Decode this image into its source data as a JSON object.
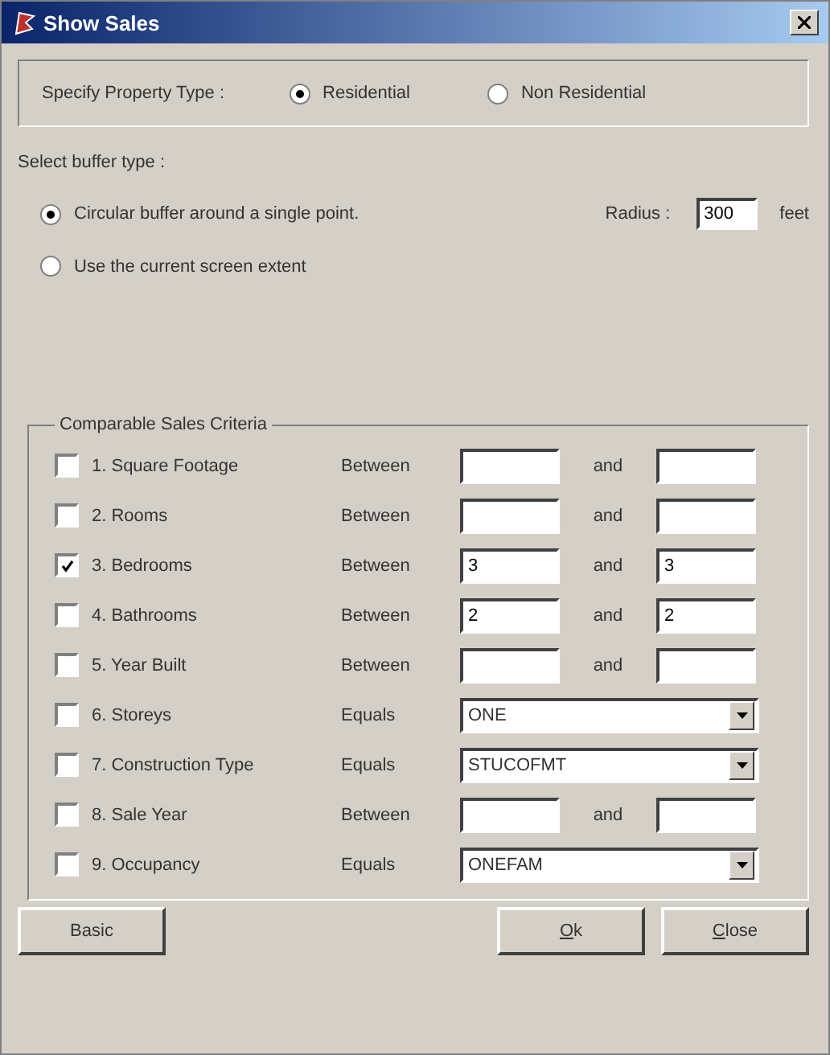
{
  "window": {
    "title": "Show Sales"
  },
  "property_type": {
    "label": "Specify Property Type :",
    "options": [
      {
        "label": "Residential",
        "selected": true
      },
      {
        "label": "Non Residential",
        "selected": false
      }
    ]
  },
  "buffer": {
    "label": "Select buffer type :",
    "options": [
      {
        "label": "Circular buffer around a single point.",
        "selected": true
      },
      {
        "label": "Use the current screen extent",
        "selected": false
      }
    ],
    "radius_label": "Radius :",
    "radius_value": "300",
    "radius_unit": "feet"
  },
  "criteria": {
    "title": "Comparable Sales Criteria",
    "rows": [
      {
        "kind": "range",
        "label": "1. Square Footage",
        "checked": false,
        "operator": "Between",
        "from": "",
        "joiner": "and",
        "to": ""
      },
      {
        "kind": "range",
        "label": "2. Rooms",
        "checked": false,
        "operator": "Between",
        "from": "",
        "joiner": "and",
        "to": ""
      },
      {
        "kind": "range",
        "label": "3. Bedrooms",
        "checked": true,
        "operator": "Between",
        "from": "3",
        "joiner": "and",
        "to": "3"
      },
      {
        "kind": "range",
        "label": "4. Bathrooms",
        "checked": false,
        "operator": "Between",
        "from": "2",
        "joiner": "and",
        "to": "2"
      },
      {
        "kind": "range",
        "label": "5. Year Built",
        "checked": false,
        "operator": "Between",
        "from": "",
        "joiner": "and",
        "to": ""
      },
      {
        "kind": "select",
        "label": "6. Storeys",
        "checked": false,
        "operator": "Equals",
        "value": "ONE"
      },
      {
        "kind": "select",
        "label": "7. Construction Type",
        "checked": false,
        "operator": "Equals",
        "value": "STUCOFMT"
      },
      {
        "kind": "range",
        "label": "8. Sale Year",
        "checked": false,
        "operator": "Between",
        "from": "",
        "joiner": "and",
        "to": ""
      },
      {
        "kind": "select",
        "label": "9. Occupancy",
        "checked": false,
        "operator": "Equals",
        "value": "ONEFAM"
      }
    ]
  },
  "buttons": [
    {
      "label": "Basic",
      "mnemonic": false
    },
    {
      "label": "Ok",
      "mnemonic": true
    },
    {
      "label": "Close",
      "mnemonic": true
    }
  ]
}
